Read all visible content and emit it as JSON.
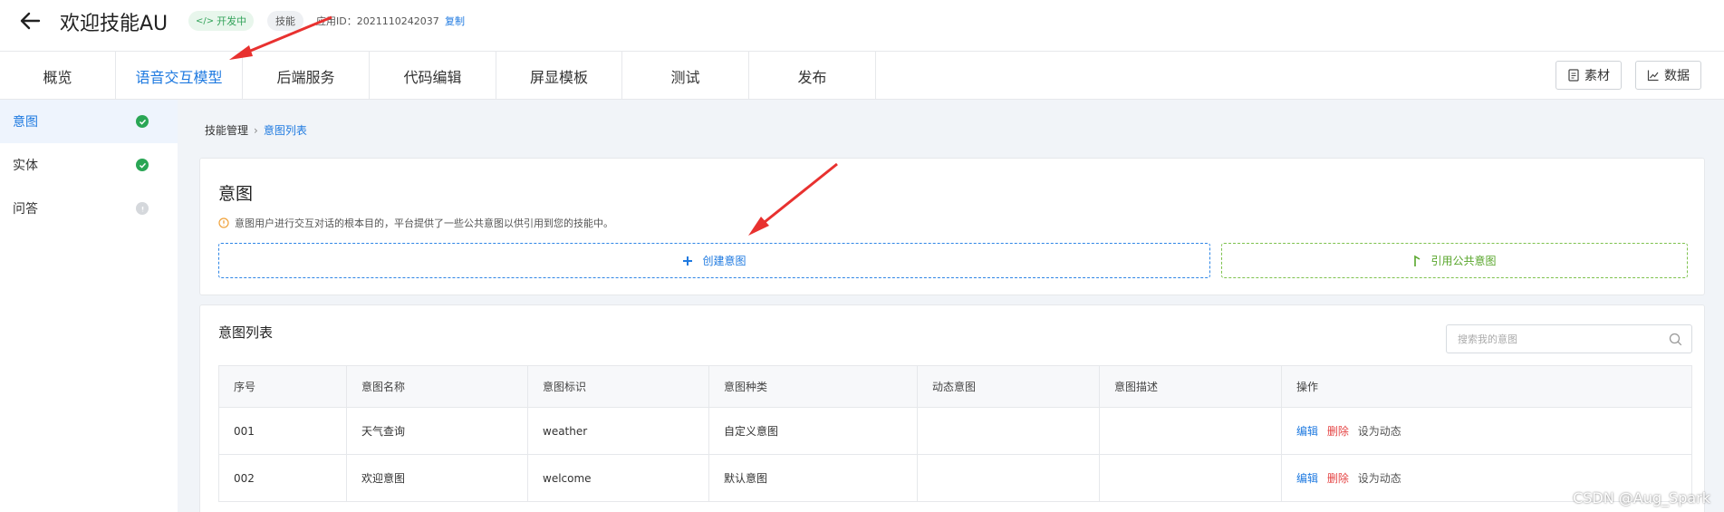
{
  "header": {
    "title": "欢迎技能AU",
    "status_badge": "开发中",
    "type_badge": "技能",
    "app_id": "应用ID：2021110242037",
    "copy_label": "复制"
  },
  "tabs": [
    {
      "label": "概览"
    },
    {
      "label": "语音交互模型"
    },
    {
      "label": "后端服务"
    },
    {
      "label": "代码编辑"
    },
    {
      "label": "屏显模板"
    },
    {
      "label": "测试"
    },
    {
      "label": "发布"
    }
  ],
  "toolbar": {
    "material_label": "素材",
    "data_label": "数据"
  },
  "sidebar": {
    "items": [
      {
        "label": "意图",
        "status": "done"
      },
      {
        "label": "实体",
        "status": "done"
      },
      {
        "label": "问答",
        "status": "pending"
      }
    ]
  },
  "breadcrumb": {
    "parent": "技能管理",
    "current": "意图列表"
  },
  "intent_card": {
    "title": "意图",
    "tip": "意图用户进行交互对话的根本目的，平台提供了一些公共意图以供引用到您的技能中。",
    "create_label": "创建意图",
    "public_label": "引用公共意图"
  },
  "list_card": {
    "title": "意图列表",
    "search_placeholder": "搜索我的意图",
    "columns": [
      "序号",
      "意图名称",
      "意图标识",
      "意图种类",
      "动态意图",
      "意图描述",
      "操作"
    ],
    "rows": [
      {
        "no": "001",
        "name": "天气查询",
        "id": "weather",
        "kind": "自定义意图",
        "dynamic": "",
        "desc": ""
      },
      {
        "no": "002",
        "name": "欢迎意图",
        "id": "welcome",
        "kind": "默认意图",
        "dynamic": "",
        "desc": ""
      }
    ],
    "ops": {
      "edit": "编辑",
      "delete": "删除",
      "dynamic": "设为动态"
    }
  },
  "watermark": "CSDN @Aug_Spark",
  "colors": {
    "accent": "#1f7ae0",
    "success": "#2aa655",
    "danger": "#e54545",
    "public": "#58a62b",
    "annotation_arrow": "#e8312f"
  }
}
